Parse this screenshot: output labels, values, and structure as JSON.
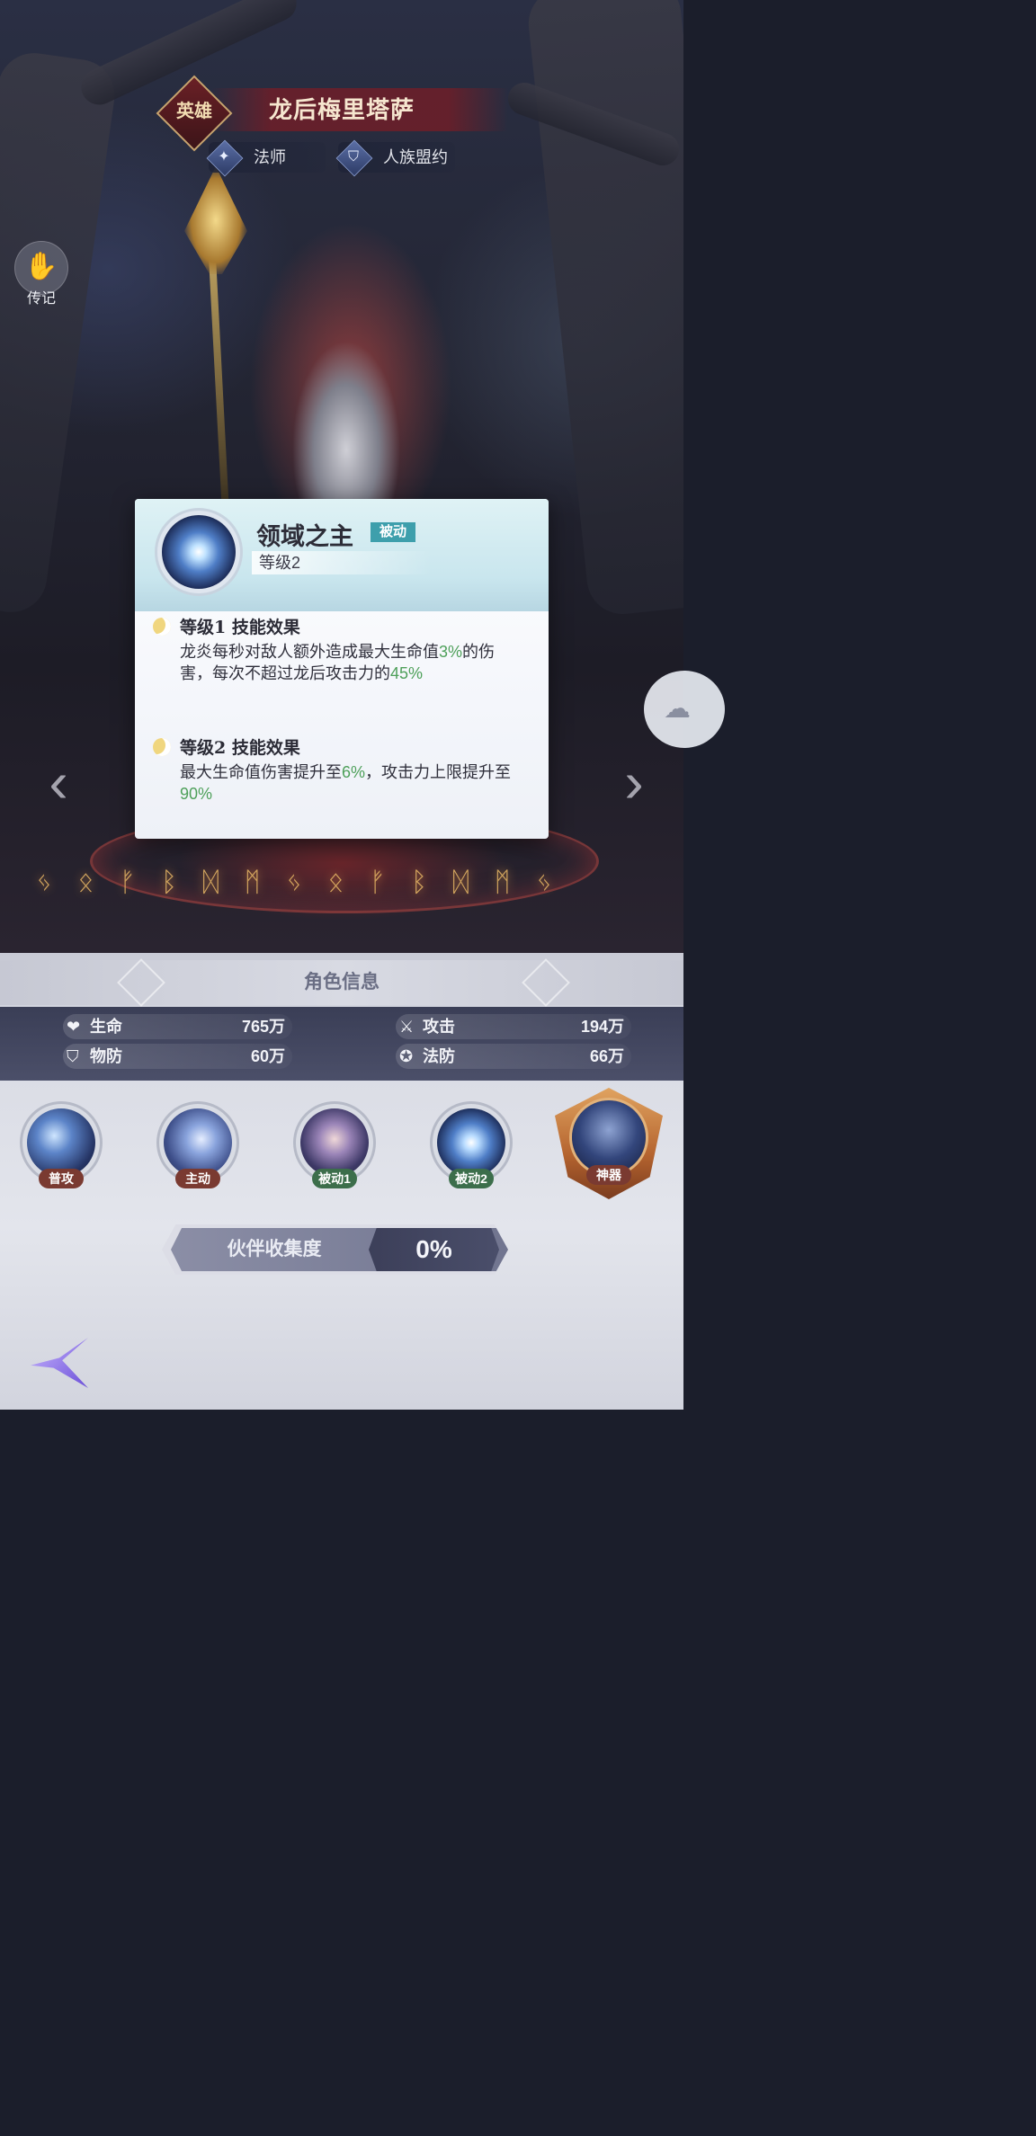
{
  "hero": {
    "rank": "英雄",
    "name": "龙后梅里塔萨",
    "class": "法师",
    "faction": "人族盟约"
  },
  "side": {
    "legend_label": "传记"
  },
  "skill_popup": {
    "name": "领域之主",
    "type_badge": "被动",
    "level": "等级2",
    "effects": [
      {
        "title": "等级1 技能效果",
        "text_parts": [
          "龙炎每秒对敌人额外造成最大生命值",
          "3%",
          "的伤害，每次不超过龙后攻击力的",
          "45%"
        ]
      },
      {
        "title": "等级2 技能效果",
        "text_parts": [
          "最大生命值伤害提升至",
          "6%",
          "，攻击力上限提升至",
          "90%"
        ]
      }
    ]
  },
  "role_info": {
    "section_title": "角色信息",
    "stats": {
      "hp": {
        "label": "生命",
        "value": "765万"
      },
      "def": {
        "label": "物防",
        "value": "60万"
      },
      "atk": {
        "label": "攻击",
        "value": "194万"
      },
      "mdef": {
        "label": "法防",
        "value": "66万"
      }
    }
  },
  "skills": [
    {
      "label": "普攻"
    },
    {
      "label": "主动"
    },
    {
      "label": "被动1"
    },
    {
      "label": "被动2"
    },
    {
      "label": "神器"
    }
  ],
  "collection": {
    "label": "伙伴收集度",
    "value": "0%"
  },
  "colors": {
    "highlight": "#4ea05a",
    "passive_badge": "#3e9fac"
  },
  "icons": {
    "legend": "handshake-icon",
    "class": "mage-icon",
    "faction": "alliance-shield-icon",
    "hp": "heart-icon",
    "def": "shield-icon",
    "atk": "sword-icon",
    "mdef": "magic-shield-icon",
    "prev": "arrow-left-icon",
    "next": "arrow-right-icon"
  }
}
